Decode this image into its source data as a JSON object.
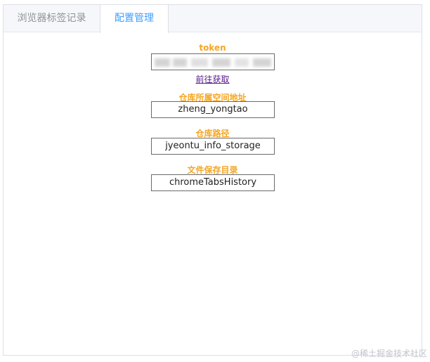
{
  "tabs": [
    {
      "label": "浏览器标签记录"
    },
    {
      "label": "配置管理"
    }
  ],
  "config": {
    "token_label": "token",
    "token_value": "",
    "token_link": "前往获取",
    "repo_space_label": "仓库所属空间地址",
    "repo_space_value": "zheng_yongtao",
    "repo_path_label": "仓库路径",
    "repo_path_value": "jyeontu_info_storage",
    "save_dir_label": "文件保存目录",
    "save_dir_value": "chromeTabsHistory"
  },
  "watermark": "@稀土掘金技术社区"
}
